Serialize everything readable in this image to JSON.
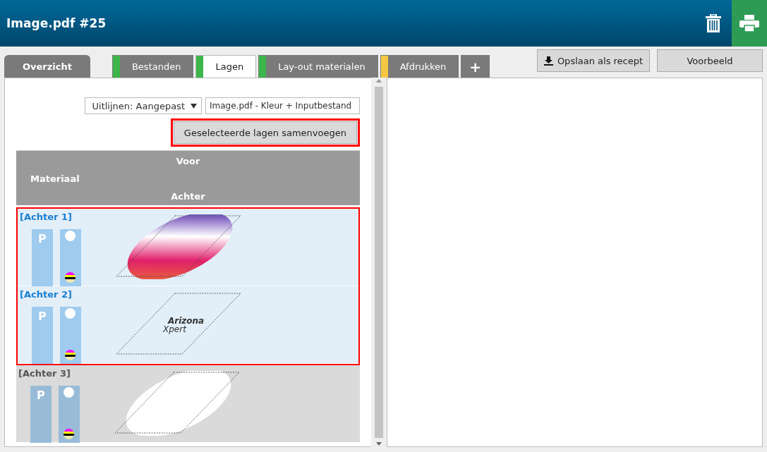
{
  "title": "Image.pdf #25",
  "tabs": [
    {
      "label": "Overzicht",
      "kind": "overview",
      "selected": false
    },
    {
      "label": "Bestanden",
      "kind": "step",
      "color": "#3cb54a",
      "selected": false
    },
    {
      "label": "Lagen",
      "kind": "step",
      "color": "#3cb54a",
      "selected": true
    },
    {
      "label": "Lay-out materialen",
      "kind": "step",
      "color": "#3cb54a",
      "selected": false
    },
    {
      "label": "Afdrukken",
      "kind": "step",
      "color": "#f5c842",
      "selected": false
    },
    {
      "label": "+",
      "kind": "add",
      "selected": false
    }
  ],
  "actions": [
    "Opslaan als recept",
    "Voorbeeld"
  ],
  "align_select": {
    "value": "Uitlijnen: Aangepast"
  },
  "file_field": {
    "value": "Image.pdf - Kleur + Inputbestand"
  },
  "merge_button": "Geselecteerde lagen samenvoegen",
  "header": {
    "front": "Voor",
    "material": "Materiaal",
    "back": "Achter"
  },
  "layers": [
    {
      "name": "[Achter 1]",
      "selected": true,
      "print_mode": "P",
      "kind": "paint"
    },
    {
      "name": "[Achter 2]",
      "selected": true,
      "print_mode": "P",
      "kind": "text",
      "thumbnail_text": [
        "Arizona",
        "Xpert"
      ]
    },
    {
      "name": "[Achter 3]",
      "selected": false,
      "print_mode": "P",
      "kind": "white"
    }
  ]
}
